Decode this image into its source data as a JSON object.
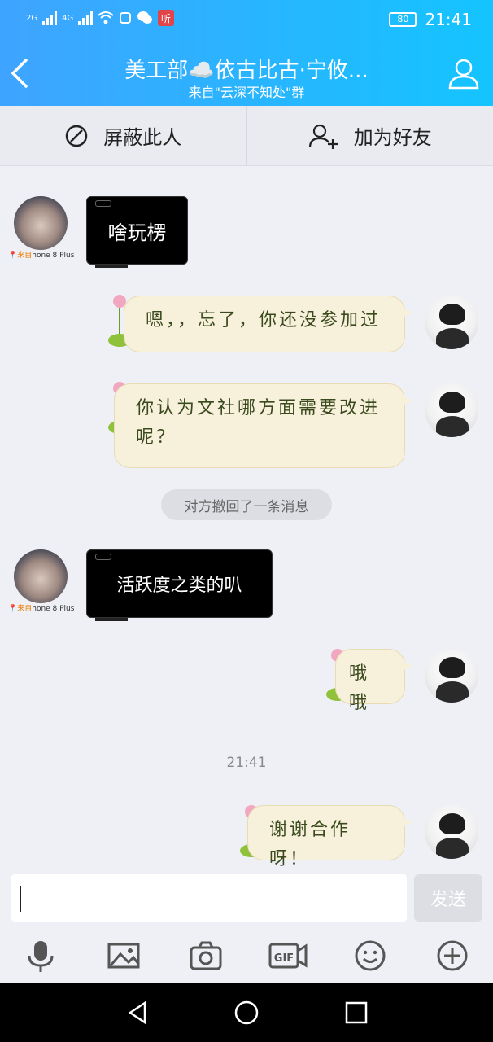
{
  "status_bar": {
    "net1": "2G",
    "net2": "4G",
    "battery": "80",
    "time": "21:41"
  },
  "header": {
    "title": "美工部☁️依古比古·宁攸...",
    "subtitle": "来自\"云深不知处\"群"
  },
  "actions": {
    "block_label": "屏蔽此人",
    "add_friend_label": "加为好友"
  },
  "messages": [
    {
      "side": "left",
      "kind": "image",
      "text": "啥玩楞",
      "device_prefix": "来自",
      "device": "hone 8 Plus"
    },
    {
      "side": "right",
      "kind": "text",
      "text": "嗯，，忘了，你还没参加过"
    },
    {
      "side": "right",
      "kind": "text",
      "text": "你认为文社哪方面需要改进呢？"
    },
    {
      "side": "left",
      "kind": "image",
      "text": "活跃度之类的叭",
      "device_prefix": "来自",
      "device": "hone 8 Plus"
    },
    {
      "side": "right",
      "kind": "text",
      "text": "哦哦"
    },
    {
      "side": "right",
      "kind": "text",
      "text": "谢谢合作呀！"
    }
  ],
  "recall_notice": "对方撤回了一条消息",
  "timestamp": "21:41",
  "input": {
    "placeholder": "",
    "send_label": "发送"
  },
  "toolbar_icons": [
    "microphone-icon",
    "image-icon",
    "camera-icon",
    "gif-icon",
    "emoji-icon",
    "plus-icon"
  ],
  "colors": {
    "header_from": "#3fa4ff",
    "header_to": "#14c4ff",
    "paper": "#f7f0da"
  }
}
